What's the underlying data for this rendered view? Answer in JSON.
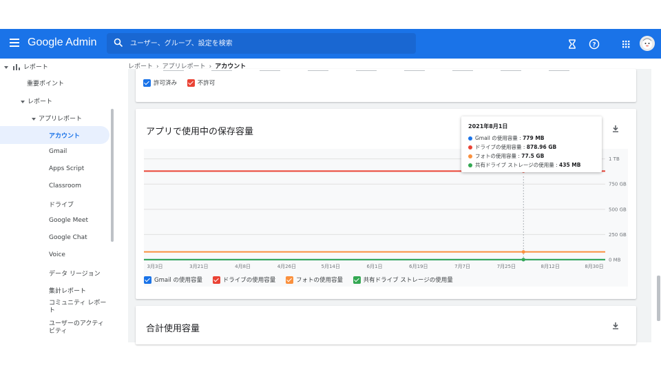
{
  "header": {
    "brand": "Google Admin",
    "search_placeholder": "ユーザー、グループ、設定を検索",
    "icons": [
      "menu-icon",
      "search-icon",
      "hourglass-icon",
      "help-icon",
      "apps-grid-icon",
      "avatar"
    ]
  },
  "breadcrumb": [
    "レポート",
    "アプリレポート",
    "アカウント"
  ],
  "sidebar": {
    "items": [
      {
        "label": "レポート",
        "level": 0,
        "icon": "bar-chart-icon"
      },
      {
        "label": "重要ポイント",
        "level": 1
      },
      {
        "label": "レポート",
        "level": 1
      },
      {
        "label": "アプリレポート",
        "level": 2
      },
      {
        "label": "アカウント",
        "level": 3,
        "active": true
      },
      {
        "label": "Gmail",
        "level": 3
      },
      {
        "label": "Apps Script",
        "level": 3
      },
      {
        "label": "Classroom",
        "level": 3
      },
      {
        "label": "ドライブ",
        "level": 3
      },
      {
        "label": "Google Meet",
        "level": 3
      },
      {
        "label": "Google Chat",
        "level": 3
      },
      {
        "label": "Voice",
        "level": 3
      },
      {
        "label": "データ リージョン",
        "level": 3
      },
      {
        "label": "集計レポート",
        "level": 3
      },
      {
        "label": "コミュニティ レポート",
        "level": 3
      },
      {
        "label": "ユーザーのアクティビティ",
        "level": 3
      }
    ]
  },
  "top_card": {
    "legend": [
      {
        "label": "許可済み",
        "color": "#1a73e8"
      },
      {
        "label": "不許可",
        "color": "#ea4335"
      }
    ]
  },
  "storage_card": {
    "title": "アプリで使用中の保存容量",
    "legend": [
      {
        "label": "Gmail の使用容量",
        "color": "#1a73e8"
      },
      {
        "label": "ドライブの使用容量",
        "color": "#ea4335"
      },
      {
        "label": "フォトの使用容量",
        "color": "#fa903e"
      },
      {
        "label": "共有ドライブ ストレージの使用量",
        "color": "#34a853"
      }
    ],
    "tooltip": {
      "date": "2021年8月1日",
      "rows": [
        {
          "label": "Gmail の使用容量 : ",
          "value": "779 MB",
          "color": "#1a73e8"
        },
        {
          "label": "ドライブの使用容量 : ",
          "value": "878.96 GB",
          "color": "#ea4335"
        },
        {
          "label": "フォトの使用容量 : ",
          "value": "77.5 GB",
          "color": "#fa903e"
        },
        {
          "label": "共有ドライブ ストレージの使用量 : ",
          "value": "435 MB",
          "color": "#34a853"
        }
      ]
    }
  },
  "total_card": {
    "title": "合計使用容量"
  },
  "chart_data": {
    "type": "line",
    "x": [
      "3月3日",
      "3月21日",
      "4月8日",
      "4月26日",
      "5月14日",
      "6月1日",
      "6月19日",
      "7月7日",
      "7月25日",
      "8月12日",
      "8月30日"
    ],
    "ylim": [
      0,
      1100
    ],
    "y_ticks": [
      "0 MB",
      "250 GB",
      "500 GB",
      "750 GB",
      "1 TB"
    ],
    "y_tick_values": [
      0,
      250,
      500,
      750,
      1000
    ],
    "highlight_date": "8月1日",
    "series": [
      {
        "name": "Gmail の使用容量",
        "color": "#1a73e8",
        "values_gb": [
          0.779,
          0.779,
          0.779,
          0.779,
          0.779,
          0.779,
          0.779,
          0.779,
          0.779,
          0.779,
          0.779
        ],
        "highlight_value": 0.779
      },
      {
        "name": "ドライブの使用容量",
        "color": "#ea4335",
        "values_gb": [
          878.96,
          878.96,
          878.96,
          878.96,
          878.96,
          878.96,
          878.96,
          878.96,
          878.96,
          878.96,
          878.96
        ],
        "highlight_value": 878.96
      },
      {
        "name": "フォトの使用容量",
        "color": "#fa903e",
        "values_gb": [
          77.5,
          77.5,
          77.5,
          77.5,
          77.5,
          77.5,
          77.5,
          77.5,
          77.5,
          77.5,
          77.5
        ],
        "highlight_value": 77.5
      },
      {
        "name": "共有ドライブ ストレージの使用量",
        "color": "#34a853",
        "values_gb": [
          0.435,
          0.435,
          0.435,
          0.435,
          0.435,
          0.435,
          0.435,
          0.435,
          0.435,
          0.435,
          0.435
        ],
        "highlight_value": 0.435
      }
    ]
  }
}
